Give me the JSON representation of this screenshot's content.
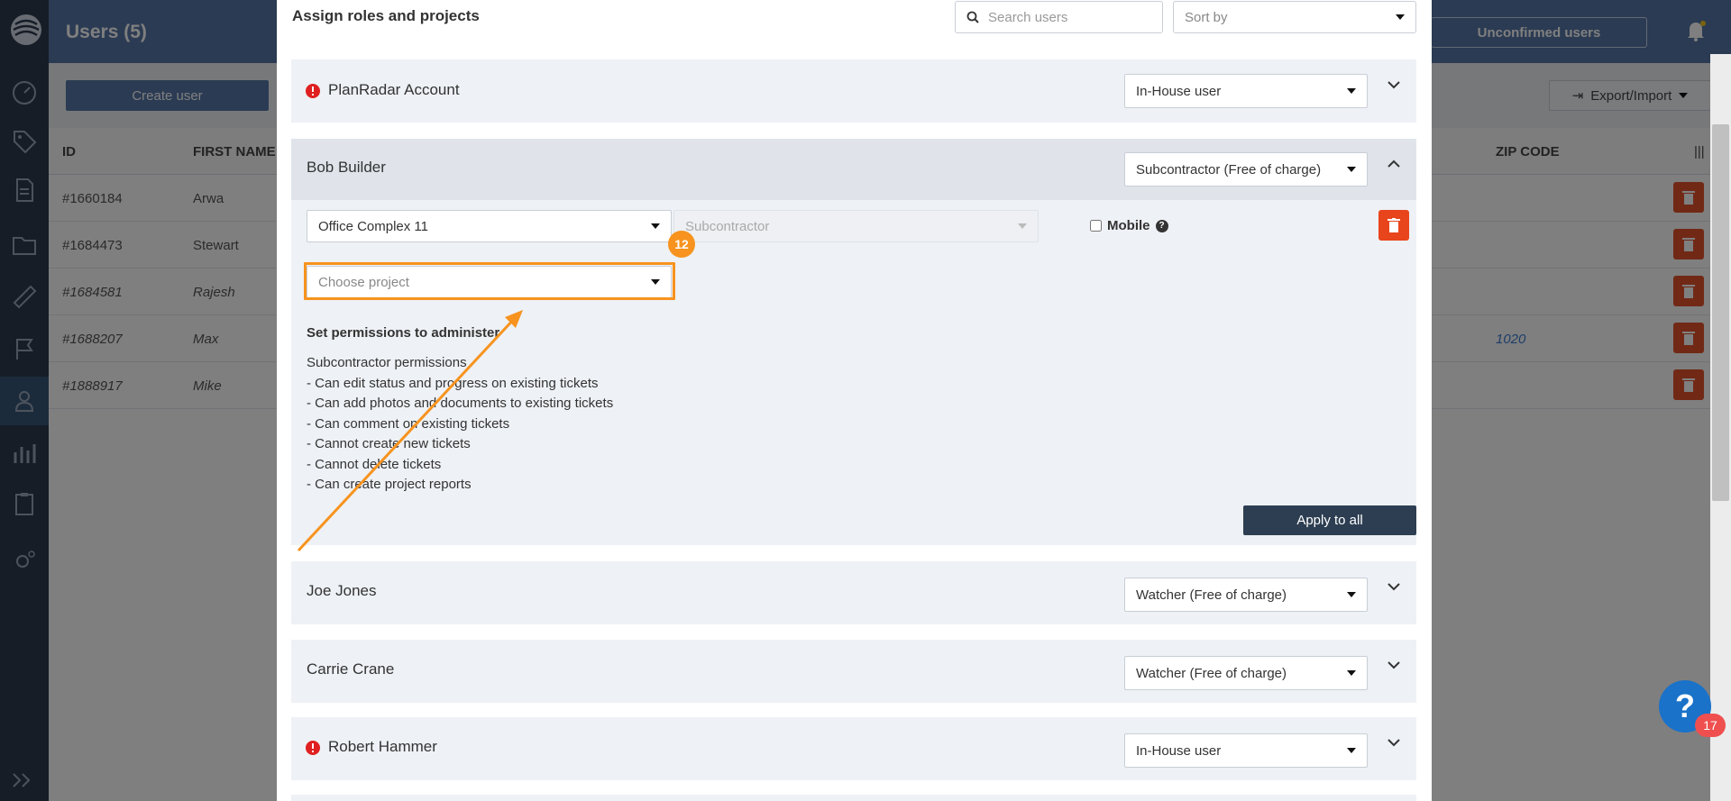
{
  "background": {
    "title": "Users (5)",
    "unconfirmed_button": "Unconfirmed users",
    "create_button": "Create user",
    "export_button": "Export/Import",
    "table": {
      "columns": [
        "ID",
        "FIRST NAME",
        "ZIP CODE"
      ],
      "rows": [
        {
          "id": "#1660184",
          "first_name": "Arwa",
          "zip": ""
        },
        {
          "id": "#1684473",
          "first_name": "Stewart",
          "zip": ""
        },
        {
          "id": "#1684581",
          "first_name": "Rajesh",
          "zip": ""
        },
        {
          "id": "#1688207",
          "first_name": "Max",
          "zip": "1020"
        },
        {
          "id": "#1888917",
          "first_name": "Mike",
          "zip": ""
        }
      ]
    }
  },
  "modal": {
    "title": "Assign roles and projects",
    "search_placeholder": "Search users",
    "sort_placeholder": "Sort by",
    "users": [
      {
        "name": "PlanRadar Account",
        "role": "In-House user",
        "warning": true
      },
      {
        "name": "Bob Builder",
        "role": "Subcontractor (Free of charge)",
        "warning": false,
        "expanded": true
      },
      {
        "name": "Joe Jones",
        "role": "Watcher (Free of charge)",
        "warning": false
      },
      {
        "name": "Carrie Crane",
        "role": "Watcher (Free of charge)",
        "warning": false
      },
      {
        "name": "Robert Hammer",
        "role": "In-House user",
        "warning": true
      }
    ],
    "bob_panel": {
      "project_selected": "Office Complex 11",
      "project_role_placeholder": "Subcontractor",
      "mobile_label": "Mobile",
      "choose_project_placeholder": "Choose project",
      "permissions_title": "Set permissions to administer",
      "permissions": [
        "Subcontractor permissions",
        "- Can edit status and progress on existing tickets",
        "- Can add photos and documents to existing tickets",
        "- Can comment on existing tickets",
        "- Cannot create new tickets",
        "- Cannot delete tickets",
        "- Can create project reports"
      ],
      "apply_button": "Apply to all"
    }
  },
  "tutorial": {
    "step_number": "12",
    "accent_color": "#f7931e"
  },
  "help": {
    "icon_text": "?",
    "badge_count": "17"
  }
}
